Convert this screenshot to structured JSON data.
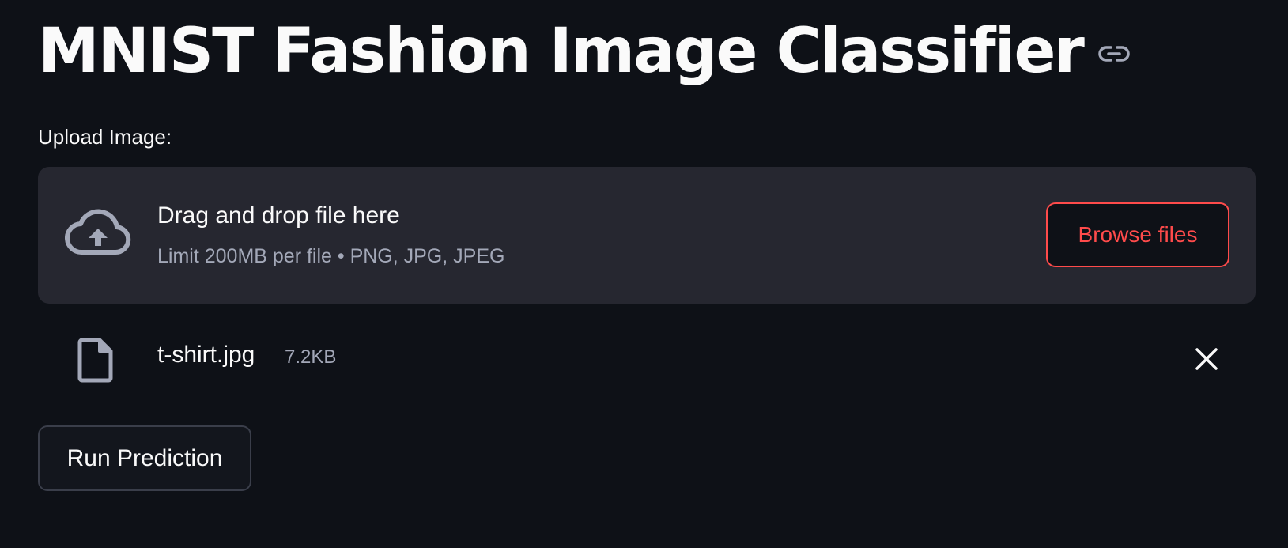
{
  "header": {
    "title": "MNIST Fashion Image Classifier",
    "anchor_icon": "link-icon"
  },
  "uploader": {
    "label": "Upload Image:",
    "dropzone_title": "Drag and drop file here",
    "limit_text": "Limit 200MB per file • PNG, JPG, JPEG",
    "browse_label": "Browse files",
    "cloud_icon": "cloud-upload-icon"
  },
  "uploaded_file": {
    "name": "t-shirt.jpg",
    "size": "7.2KB",
    "file_icon": "file-icon",
    "remove_icon": "close-icon"
  },
  "actions": {
    "run_label": "Run Prediction"
  },
  "colors": {
    "background": "#0e1117",
    "dropzone": "#262730",
    "accent": "#ff4b4b",
    "text": "#fafafa",
    "muted": "#a3a8b8"
  }
}
